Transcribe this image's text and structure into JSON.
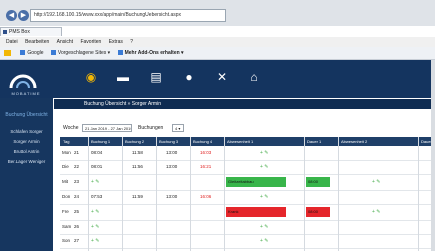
{
  "browser": {
    "address": "http://192.168.100.15/www.xxx/app/main/BuchungUebersicht.aspx",
    "tab_title": "PMS Box",
    "menu": [
      "Datei",
      "Bearbeiten",
      "Ansicht",
      "Favoriten",
      "Extras",
      "?"
    ],
    "favorites": [
      "Google",
      "Vorgeschlagene Sites ▾",
      "Mehr Add-Ons erhalten ▾"
    ]
  },
  "app": {
    "logo_text": "MOBATIME",
    "page_title": "Buchung Übersicht » Sorger Armin",
    "nav_icons": [
      "clock-icon",
      "folder-icon",
      "document-icon",
      "circle-icon",
      "tools-icon",
      "home-icon"
    ]
  },
  "sidebar": {
    "heading": "Buchung Übersicht",
    "items": [
      "Schlafen Sorger",
      "Sorger Armin",
      "Bruttol Antrin",
      "Ber.Lager Weniger"
    ]
  },
  "filter": {
    "label": "Woche",
    "week_value": "21 Jan 2019 - 27 Jan 2019 ▾",
    "buchungen_label": "Buchungen",
    "buchungen_value": "4 ▾"
  },
  "table": {
    "columns": [
      "Tag",
      "Buchung 1",
      "Buchung 2",
      "Buchung 3",
      "Buchung 4",
      "Abwesenheit 1",
      "Dauer 1",
      "Abwesenheit 2",
      "Dauer 2"
    ],
    "rows": [
      {
        "day": "Mon",
        "date": "21",
        "b1": "08:04",
        "b2": "11:58",
        "b3": "13:00",
        "b4": "16:03",
        "abw1": "+ ✎",
        "dauer1": "",
        "abw2": "",
        "dauer2": ""
      },
      {
        "day": "Die",
        "date": "22",
        "b1": "08:01",
        "b2": "11:56",
        "b3": "13:00",
        "b4": "16:21",
        "abw1": "+ ✎",
        "dauer1": "",
        "abw2": "",
        "dauer2": ""
      },
      {
        "day": "Mit",
        "date": "23",
        "b1": "+ ✎",
        "b2": "",
        "b3": "",
        "b4": "",
        "abw1_block": "Gleitzeitabbau",
        "abw1": "",
        "dauer1_block": "08:00",
        "abw2": "+ ✎",
        "dauer2": ""
      },
      {
        "day": "Don",
        "date": "24",
        "b1": "07:53",
        "b2": "11:59",
        "b3": "13:00",
        "b4": "16:06",
        "abw1": "+ ✎",
        "dauer1": "",
        "abw2": "",
        "dauer2": ""
      },
      {
        "day": "Fre",
        "date": "25",
        "b1": "+ ✎",
        "b2": "",
        "b3": "",
        "b4": "",
        "abw1_block": "Krank",
        "abw1": "",
        "dauer1_block": "08:00",
        "abw2": "+ ✎",
        "dauer2": ""
      },
      {
        "day": "Sam",
        "date": "26",
        "b1": "+ ✎",
        "b2": "",
        "b3": "",
        "b4": "",
        "abw1": "+ ✎",
        "dauer1": "",
        "abw2": "",
        "dauer2": ""
      },
      {
        "day": "Son",
        "date": "27",
        "b1": "+ ✎",
        "b2": "",
        "b3": "",
        "b4": "",
        "abw1": "+ ✎",
        "dauer1": "",
        "abw2": "",
        "dauer2": ""
      }
    ]
  },
  "colors": {
    "header_bg": "#14345f",
    "sidebar_bg": "#16365f",
    "grid_head": "#1f3f68",
    "green": "#38b54a",
    "red": "#e5262b"
  }
}
